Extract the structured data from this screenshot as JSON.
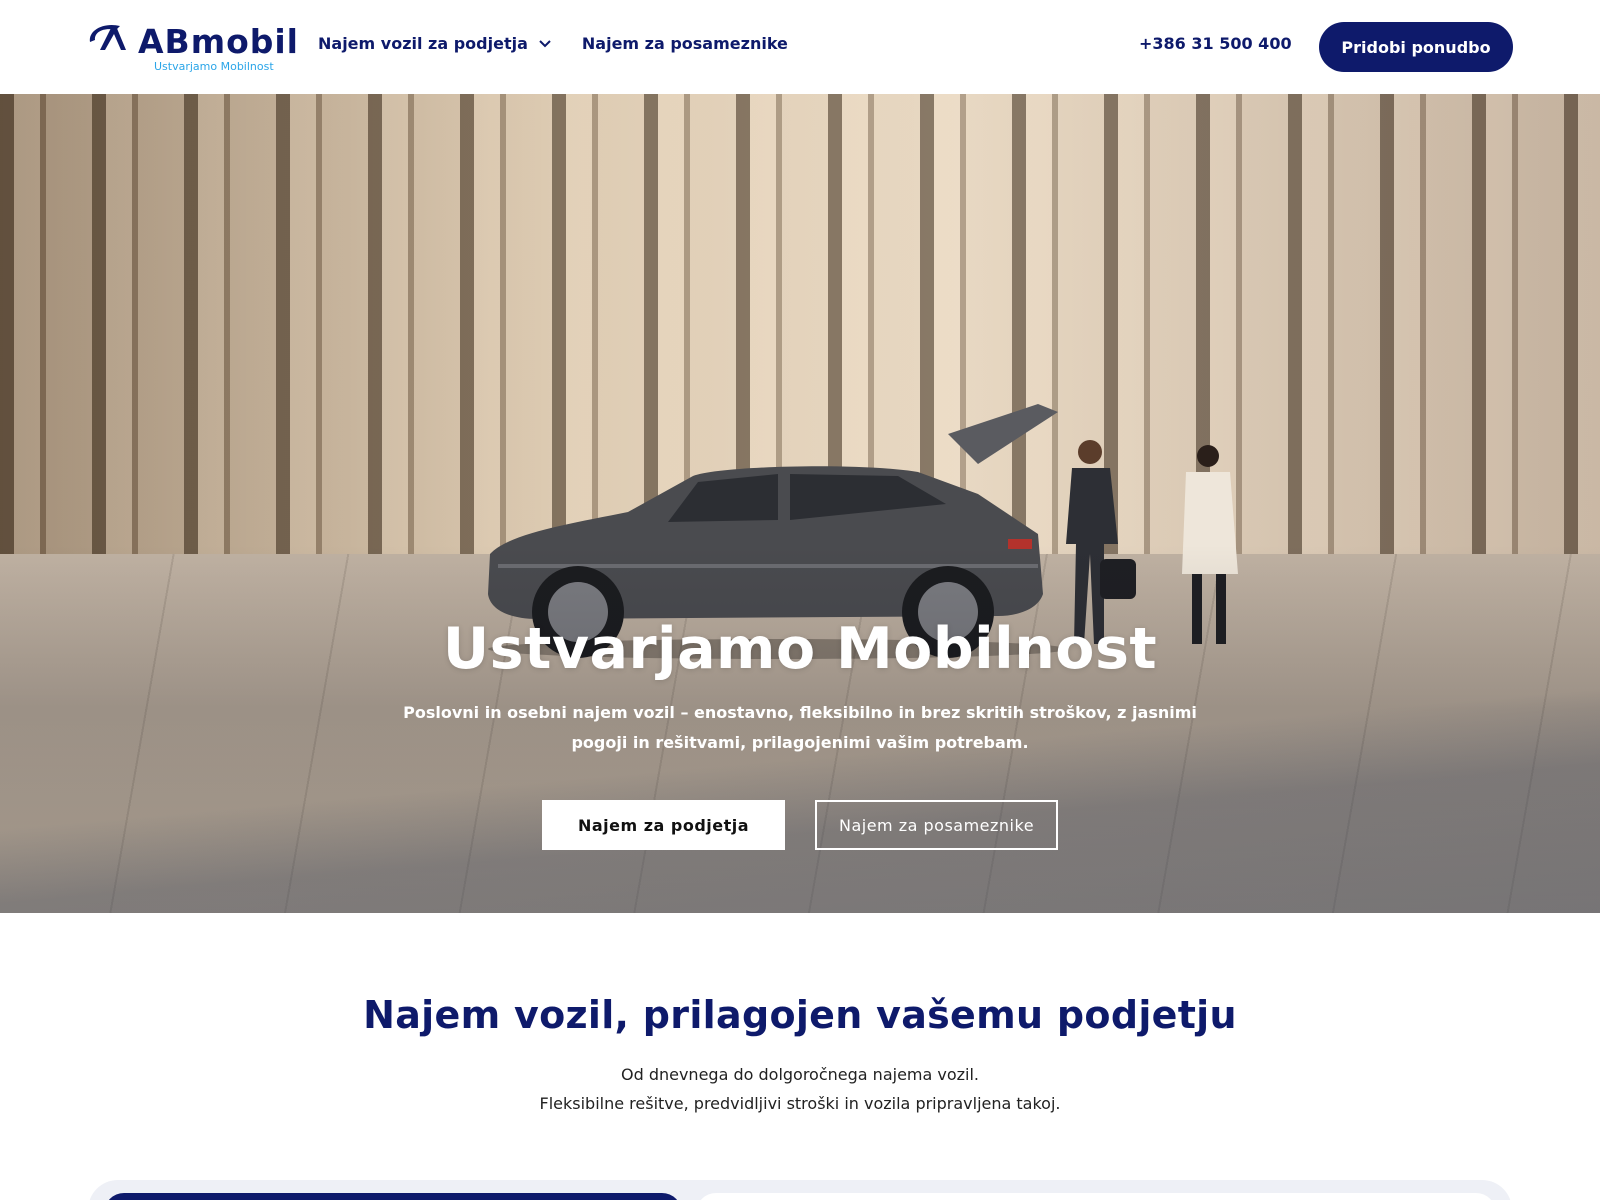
{
  "header": {
    "logo_text": "ABmobil",
    "logo_tagline": "Ustvarjamo Mobilnost",
    "nav": [
      {
        "label": "Najem vozil za podjetja",
        "has_dropdown": true
      },
      {
        "label": "Najem za posameznike",
        "has_dropdown": false
      }
    ],
    "phone": "+386 31 500 400",
    "cta_label": "Pridobi ponudbo"
  },
  "hero": {
    "title": "Ustvarjamo Mobilnost",
    "subtitle": "Poslovni in osebni najem vozil – enostavno, fleksibilno in brez skritih stroškov, z jasnimi pogoji in rešitvami, prilagojenimi vašim potrebam.",
    "button_primary": "Najem za podjetja",
    "button_secondary": "Najem za posameznike"
  },
  "section": {
    "title": "Najem vozil, prilagojen vašemu podjetju",
    "line1": "Od dnevnega do dolgoročnega najema vozil.",
    "line2": "Fleksibilne rešitve, predvidljivi stroški in vozila pripravljena takoj."
  },
  "colors": {
    "brand_navy": "#0e1a6b",
    "tagline_blue": "#2aa5e8",
    "white": "#ffffff"
  },
  "icons": {
    "dropdown": "chevron-down-icon",
    "logo": "abmobil-logo"
  }
}
